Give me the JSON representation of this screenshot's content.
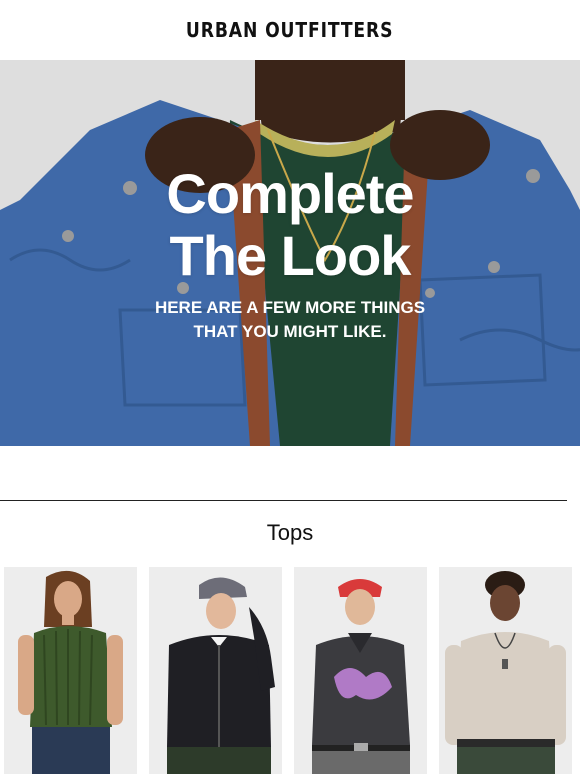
{
  "brand": {
    "logo_text": "URBAN OUTFITTERS"
  },
  "hero": {
    "title_line1": "Complete",
    "title_line2": "The Look",
    "subtitle_line1": "HERE ARE A FEW MORE THINGS",
    "subtitle_line2": "THAT YOU MIGHT LIKE.",
    "jacket_color": "#3f69a8",
    "shirt_color": "#1f4532"
  },
  "section": {
    "title": "Tops",
    "products": [
      {
        "name": "green-striped-vest",
        "color": "#3e5a2c"
      },
      {
        "name": "black-zip-jacket",
        "color": "#1f1f24"
      },
      {
        "name": "graphic-polo-shirt",
        "color": "#3b3b3f"
      },
      {
        "name": "cream-waffle-long-sleeve",
        "color": "#d8cfc4"
      }
    ]
  }
}
